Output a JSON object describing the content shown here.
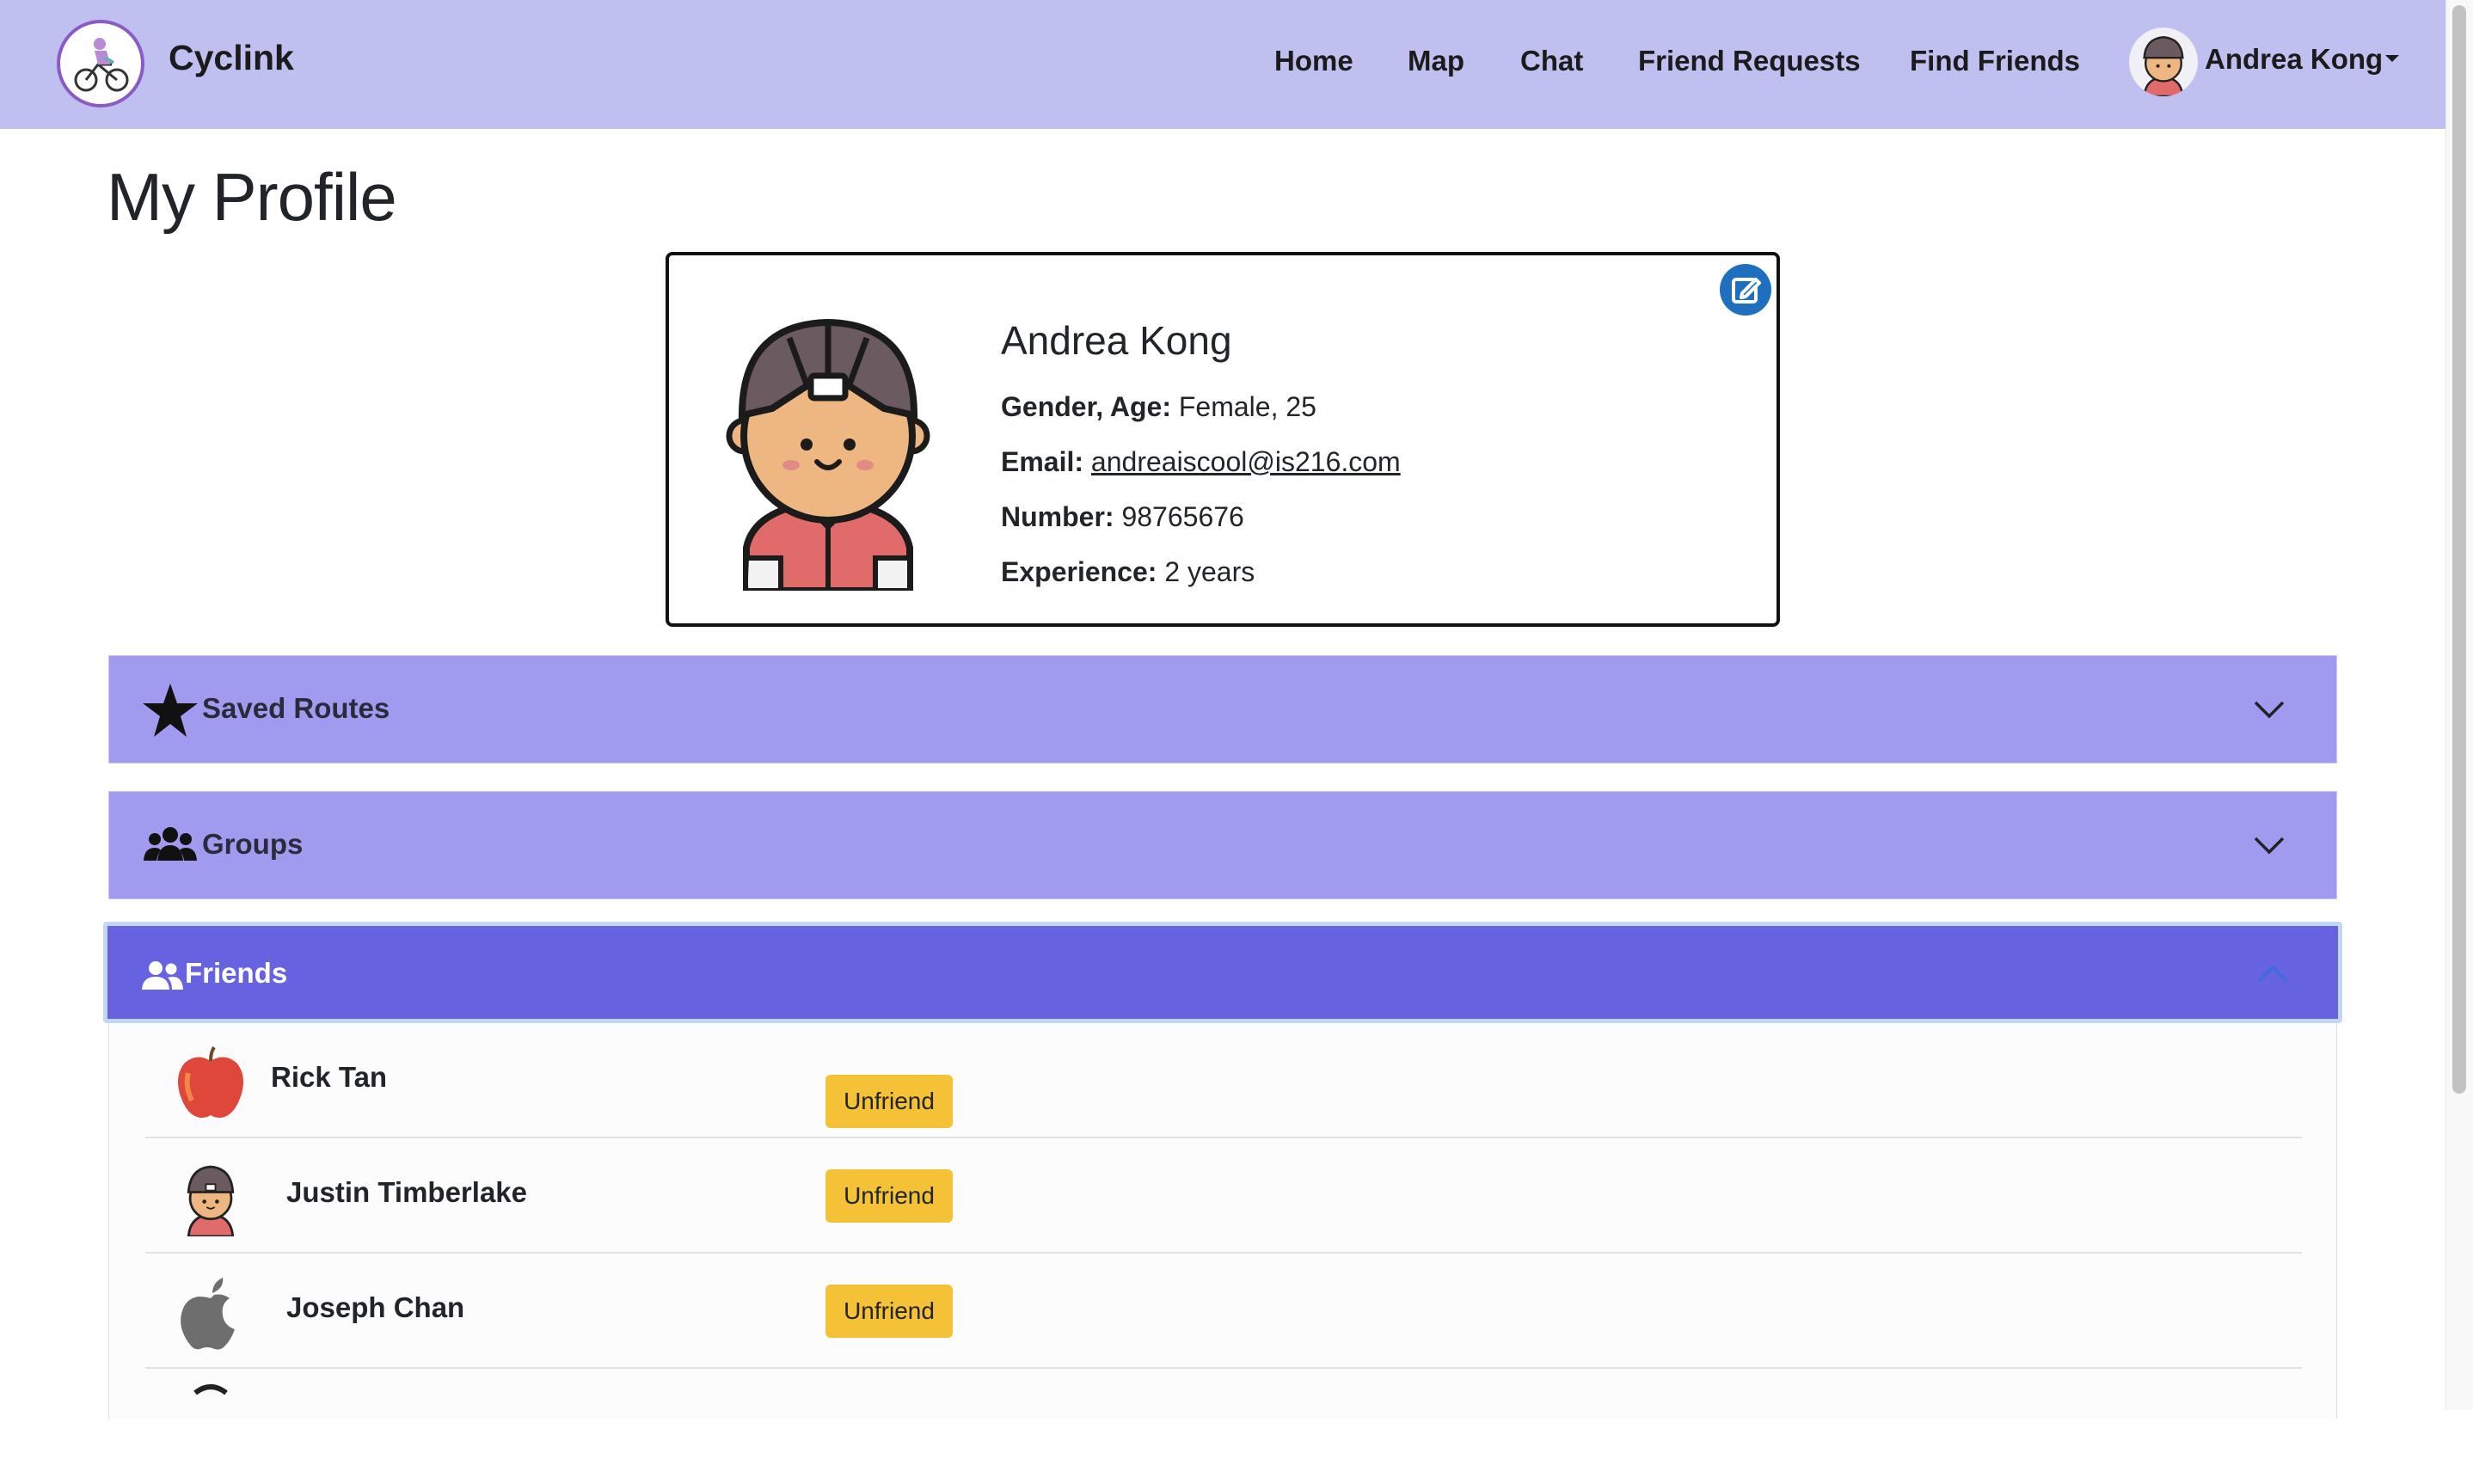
{
  "app": {
    "brand": "Cyclink"
  },
  "nav": {
    "links": [
      "Home",
      "Map",
      "Chat",
      "Friend Requests",
      "Find Friends"
    ],
    "user_name": "Andrea Kong"
  },
  "page": {
    "title": "My Profile"
  },
  "profile": {
    "name": "Andrea Kong",
    "gender_age_label": "Gender, Age:",
    "gender_age_value": "Female, 25",
    "email_label": "Email:",
    "email_value": "andreaiscool@is216.com",
    "number_label": "Number:",
    "number_value": "98765676",
    "experience_label": "Experience:",
    "experience_value": "2 years"
  },
  "sections": {
    "saved_routes": "Saved Routes",
    "groups": "Groups",
    "friends": "Friends"
  },
  "friends": [
    {
      "name": "Rick Tan",
      "avatar_icon": "apple-fruit-icon",
      "action": "Unfriend"
    },
    {
      "name": "Justin Timberlake",
      "avatar_icon": "cyclist-avatar-icon",
      "action": "Unfriend"
    },
    {
      "name": "Joseph Chan",
      "avatar_icon": "apple-logo-icon",
      "action": "Unfriend"
    }
  ],
  "colors": {
    "navbar": "#bfbff0",
    "accordion": "#a19bf0",
    "accordion_active": "#6762e0",
    "unfriend_button": "#f5c136",
    "edit_button": "#1f6fbf"
  }
}
